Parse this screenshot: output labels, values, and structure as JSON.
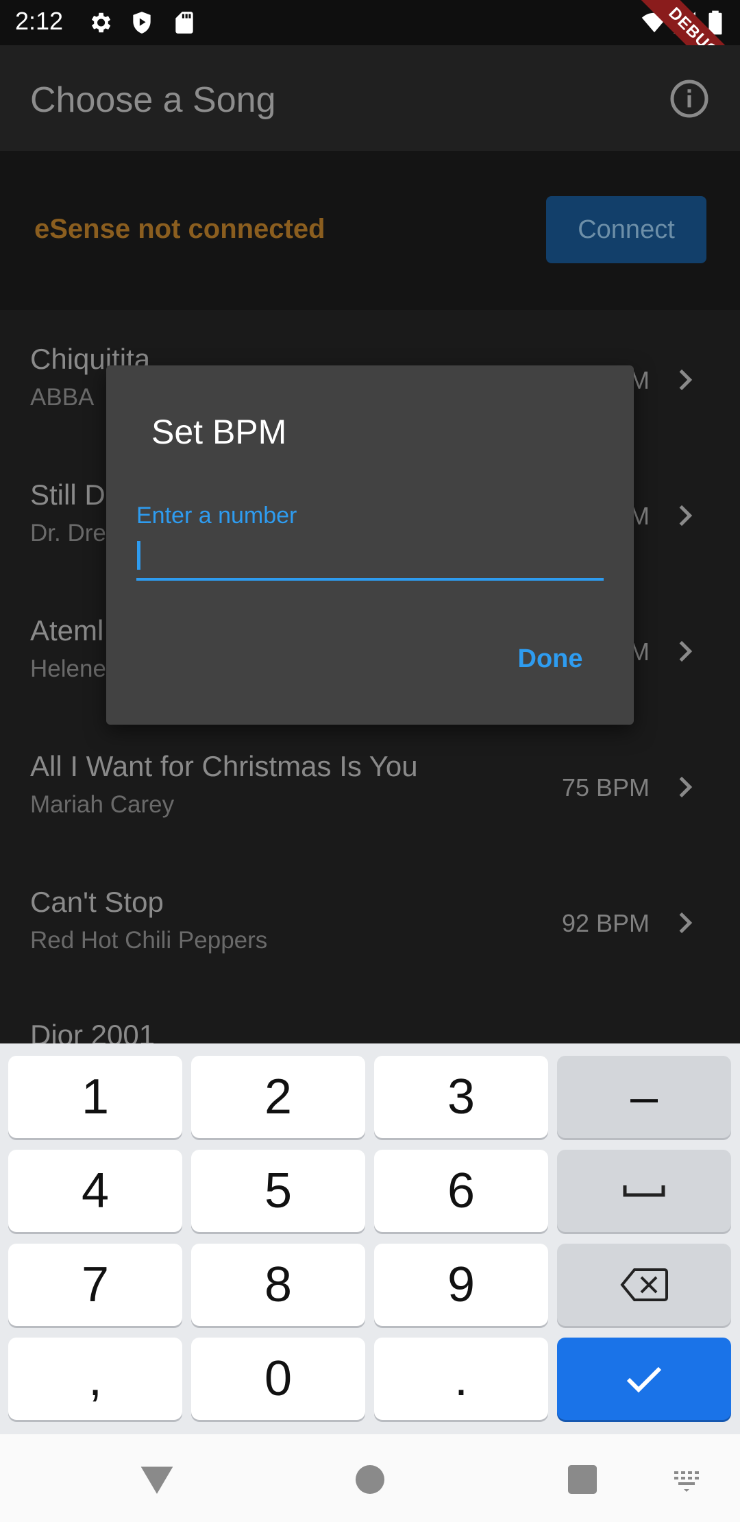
{
  "status_bar": {
    "time": "2:12",
    "icons": [
      "gear-icon",
      "shield-play-icon",
      "sd-card-icon",
      "wifi-icon",
      "signal-icon",
      "battery-icon"
    ],
    "debug_banner": "DEBUG"
  },
  "app_bar": {
    "title": "Choose a Song",
    "info_icon": "info-icon"
  },
  "connection": {
    "status": "eSense not connected",
    "connect_label": "Connect",
    "status_color": "#8b5e1f"
  },
  "songs": [
    {
      "title": "Chiquitita",
      "artist": "ABBA",
      "bpm": "M"
    },
    {
      "title": "Still D",
      "artist": "Dr. Dre",
      "bpm": "M"
    },
    {
      "title": "Ateml",
      "artist": "Helene",
      "bpm": "M"
    },
    {
      "title": "All I Want for Christmas Is You",
      "artist": "Mariah Carey",
      "bpm": "75 BPM"
    },
    {
      "title": "Can't Stop",
      "artist": "Red Hot Chili Peppers",
      "bpm": "92 BPM"
    },
    {
      "title": "Dior 2001",
      "artist": "",
      "bpm": ""
    }
  ],
  "dialog": {
    "title": "Set BPM",
    "input_label": "Enter a number",
    "input_value": "",
    "done_label": "Done",
    "accent_color": "#2e9cf0"
  },
  "keyboard": {
    "rows": [
      [
        "1",
        "2",
        "3",
        "–"
      ],
      [
        "4",
        "5",
        "6",
        "space-icon"
      ],
      [
        "7",
        "8",
        "9",
        "backspace-icon"
      ],
      [
        ",",
        "0",
        ".",
        "check-icon"
      ]
    ],
    "accent_color": "#1a73e8"
  },
  "nav_bar": {
    "icons": [
      "back-triangle-icon",
      "home-circle-icon",
      "recents-square-icon",
      "keyboard-switch-icon"
    ]
  }
}
